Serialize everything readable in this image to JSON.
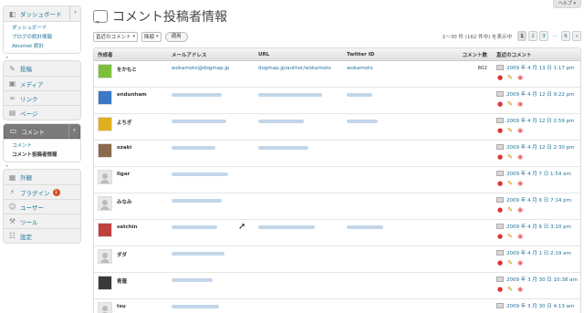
{
  "help_label": "ヘルプ ▾",
  "sidebar": {
    "dashboard": {
      "label": "ダッシュボード",
      "icon": "dashboard-icon",
      "sub": [
        "ダッシュボード",
        "ブログの統計情報",
        "Akismet 統計"
      ]
    },
    "group1": [
      {
        "label": "投稿",
        "icon": "pin-icon"
      },
      {
        "label": "メディア",
        "icon": "media-icon"
      },
      {
        "label": "リンク",
        "icon": "link-icon"
      },
      {
        "label": "ページ",
        "icon": "page-icon"
      }
    ],
    "comments": {
      "label": "コメント",
      "icon": "comment-icon",
      "sub": [
        "コメント",
        "コメント投稿者情報"
      ]
    },
    "group2": [
      {
        "label": "外観",
        "icon": "appearance-icon"
      },
      {
        "label": "プラグイン",
        "icon": "plugin-icon",
        "badge": "1"
      },
      {
        "label": "ユーザー",
        "icon": "users-icon"
      },
      {
        "label": "ツール",
        "icon": "tools-icon"
      },
      {
        "label": "設定",
        "icon": "settings-icon"
      }
    ]
  },
  "page": {
    "title": "コメント投稿者情報",
    "icon": "comment-bubble-icon"
  },
  "toolbar": {
    "sort_select": "直近のコメント",
    "order_select": "降順",
    "apply_button": "適用",
    "count_text": "1～30 件 (162 件中) を表示中",
    "pages": [
      "1",
      "2",
      "3",
      "…",
      "6",
      "»"
    ],
    "current_page": "1"
  },
  "table": {
    "headers": [
      "作成者",
      "メールアドレス",
      "URL",
      "Twitter ID",
      "コメント数",
      "直近のコメント"
    ],
    "rows": [
      {
        "name": "をかもと",
        "email": "wokamoto@dogmap.jp",
        "url": "dogmap.jp/author/wokamoto",
        "twitter": "wokamoto",
        "count": "802",
        "date": "2009 年 4 月 13 日 1:17 pm"
      },
      {
        "name": "endunham",
        "email": "",
        "url": "",
        "twitter": "",
        "count": "",
        "date": "2009 年 4 月 12 日 9:22 pm"
      },
      {
        "name": "よちぎ",
        "email": "",
        "url": "",
        "twitter": "",
        "count": "",
        "date": "2009 年 4 月 12 日 2:59 pm"
      },
      {
        "name": "ozaki",
        "email": "",
        "url": "",
        "twitter": "",
        "count": "",
        "date": "2009 年 4 月 12 日 2:30 pm"
      },
      {
        "name": "Ilgar",
        "email": "",
        "url": "",
        "twitter": "",
        "count": "",
        "date": "2009 年 4 月 7 日 1:54 am"
      },
      {
        "name": "みなみ",
        "email": "",
        "url": "",
        "twitter": "",
        "count": "",
        "date": "2009 年 4 月 6 日 7:14 pm"
      },
      {
        "name": "satchin",
        "email": "",
        "url": "",
        "twitter": "",
        "count": "",
        "date": "2009 年 4 月 6 日 3:10 pm"
      },
      {
        "name": "ダダ",
        "email": "",
        "url": "",
        "twitter": "",
        "count": "",
        "date": "2009 年 4 月 1 日 2:19 am"
      },
      {
        "name": "青蓮",
        "email": "",
        "url": "",
        "twitter": "",
        "count": "",
        "date": "2009 年 3 月 30 日 10:38 am"
      },
      {
        "name": "tsu",
        "email": "",
        "url": "",
        "twitter": "",
        "count": "",
        "date": "2009 年 3 月 30 日 4:13 am"
      }
    ]
  },
  "colors": {
    "link": "#21759b",
    "active_menu": "#7a7a7a",
    "badge": "#d54e21"
  }
}
